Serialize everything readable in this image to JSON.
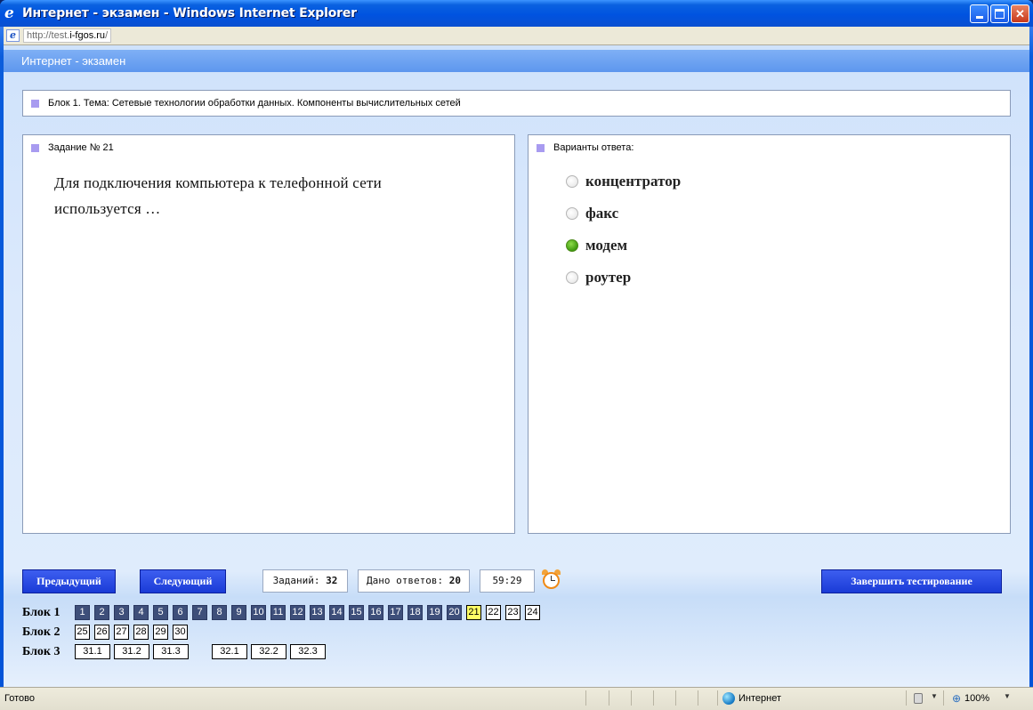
{
  "window": {
    "title": "Интернет - экзамен - Windows Internet Explorer",
    "url_prefix": "http://test.",
    "url_domain": "i-fgos.ru",
    "url_suffix": "/"
  },
  "app": {
    "header": "Интернет - экзамен",
    "topic": "Блок 1. Тема: Сетевые технологии обработки данных. Компоненты вычислительных сетей",
    "task_label": "Задание № 21",
    "question": "Для подключения компьютера к телефонной сети используется …",
    "answers_label": "Варианты ответа:",
    "options": [
      {
        "label": "концентратор",
        "selected": false
      },
      {
        "label": "факс",
        "selected": false
      },
      {
        "label": "модем",
        "selected": true
      },
      {
        "label": "роутер",
        "selected": false
      }
    ],
    "buttons": {
      "prev": "Предыдущий",
      "next": "Следующий",
      "finish": "Завершить тестирование"
    },
    "stats": {
      "tasks_label": "Заданий:",
      "tasks_value": "32",
      "answered_label": "Дано ответов:",
      "answered_value": "20",
      "timer": "59:29"
    },
    "blocks": [
      {
        "label": "Блок 1",
        "items": [
          "1",
          "2",
          "3",
          "4",
          "5",
          "6",
          "7",
          "8",
          "9",
          "10",
          "11",
          "12",
          "13",
          "14",
          "15",
          "16",
          "17",
          "18",
          "19",
          "20",
          "21",
          "22",
          "23",
          "24"
        ],
        "answered": 20,
        "current": "21"
      },
      {
        "label": "Блок 2",
        "items": [
          "25",
          "26",
          "27",
          "28",
          "29",
          "30"
        ],
        "answered": 0,
        "current": null
      },
      {
        "label": "Блок 3",
        "items": [
          "31.1",
          "31.2",
          "31.3",
          "32.1",
          "32.2",
          "32.3"
        ],
        "answered": 0,
        "current": null
      }
    ]
  },
  "statusbar": {
    "status": "Готово",
    "zone": "Интернет",
    "zoom": "100%"
  },
  "colors": {
    "answered_cell": "#3e4f7a",
    "current_cell": "#ffff66",
    "button_blue": "#1a3bd6",
    "marker": "#a89bf0"
  },
  "icons": [
    "ie-logo-icon",
    "page-icon",
    "alarm-clock-icon",
    "globe-icon",
    "lock-icon",
    "zoom-icon"
  ]
}
